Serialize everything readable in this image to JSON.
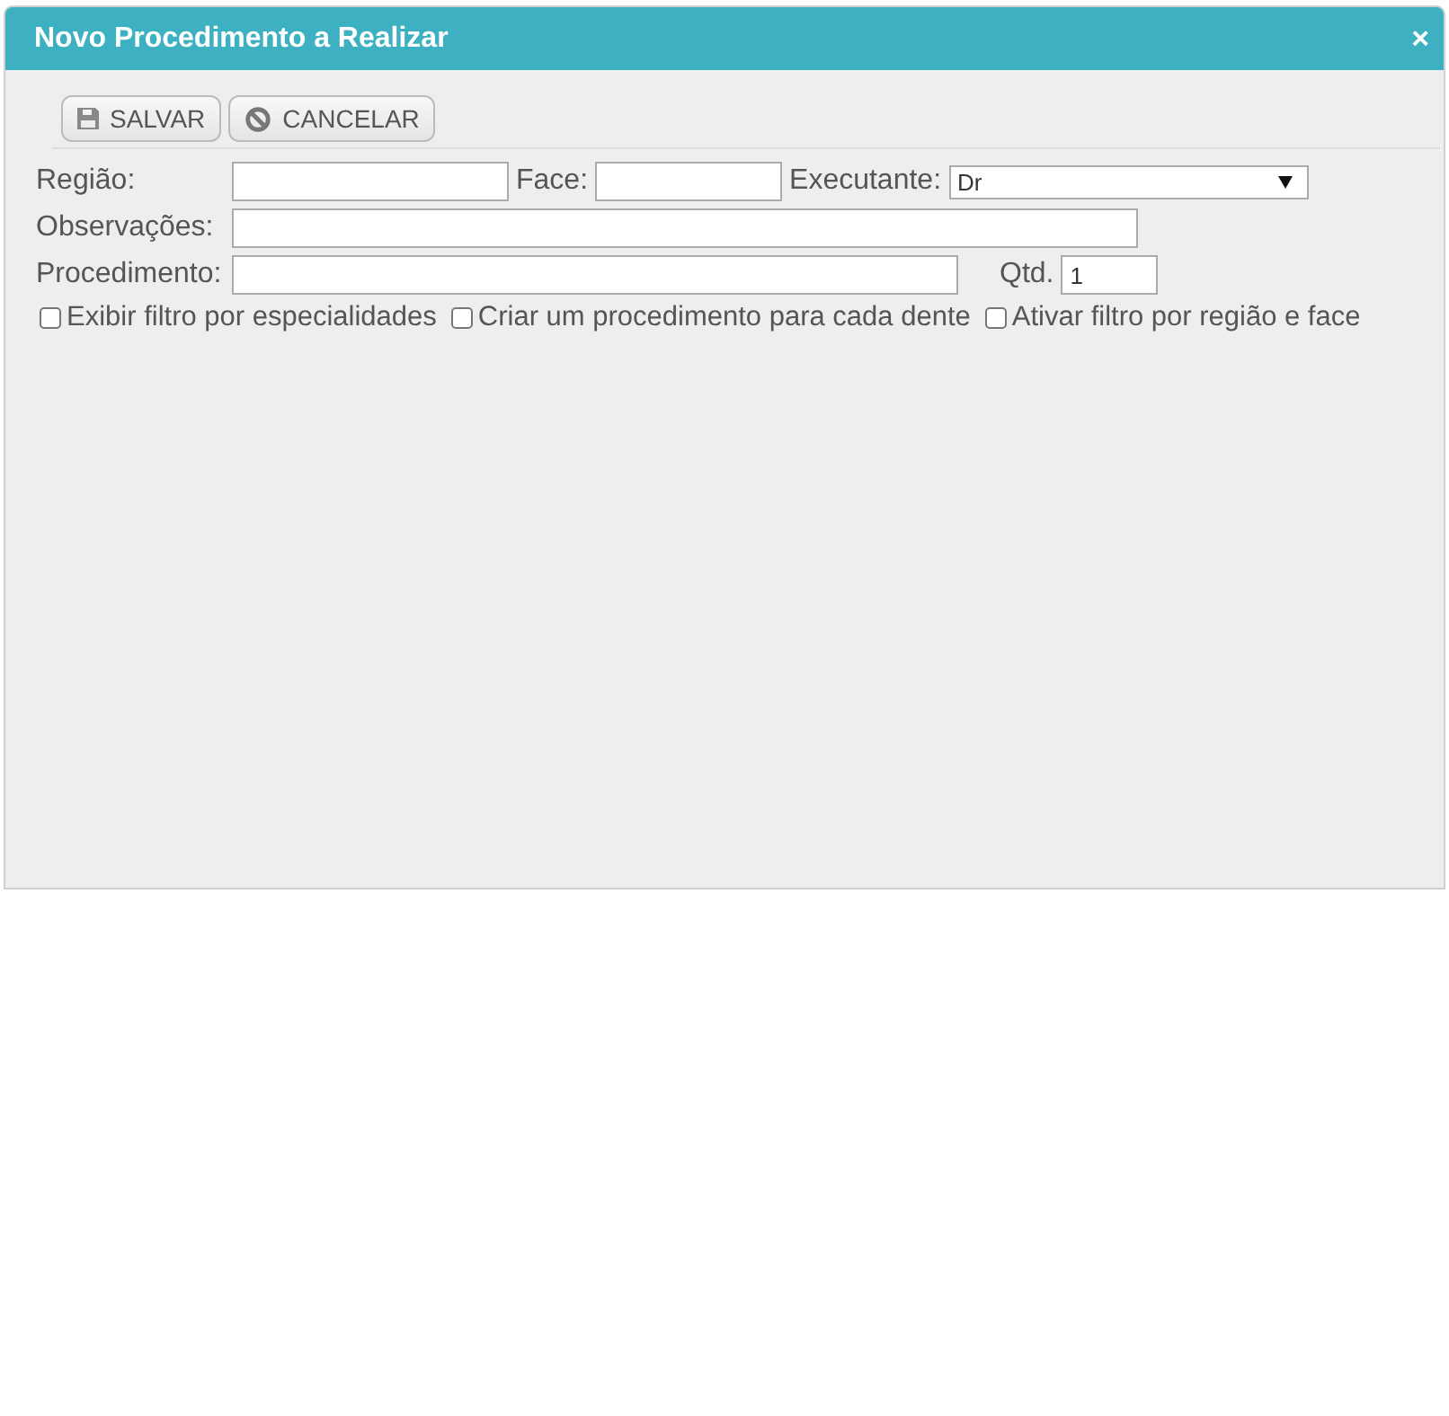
{
  "window": {
    "title": "Novo Procedimento a Realizar",
    "close": "×"
  },
  "toolbar": [
    {
      "kind": "save",
      "label": "SALVAR"
    },
    {
      "kind": "cancel",
      "label": "CANCELAR"
    }
  ],
  "form": {
    "regiao": {
      "label": "Região:"
    },
    "face": {
      "label": "Face:"
    },
    "executante": {
      "label": "Executante:",
      "value": "Dr"
    },
    "observacoes": {
      "label": "Observações:"
    },
    "procedimento": {
      "label": "Procedimento:"
    },
    "qtd": {
      "label": "Qtd.",
      "value": "1"
    }
  },
  "options": [
    {
      "label": "Exibir filtro por especialidades",
      "checked": false
    },
    {
      "label": "Criar um procedimento para cada dente",
      "checked": false
    },
    {
      "label": "Ativar filtro por região e face",
      "checked": false
    }
  ]
}
